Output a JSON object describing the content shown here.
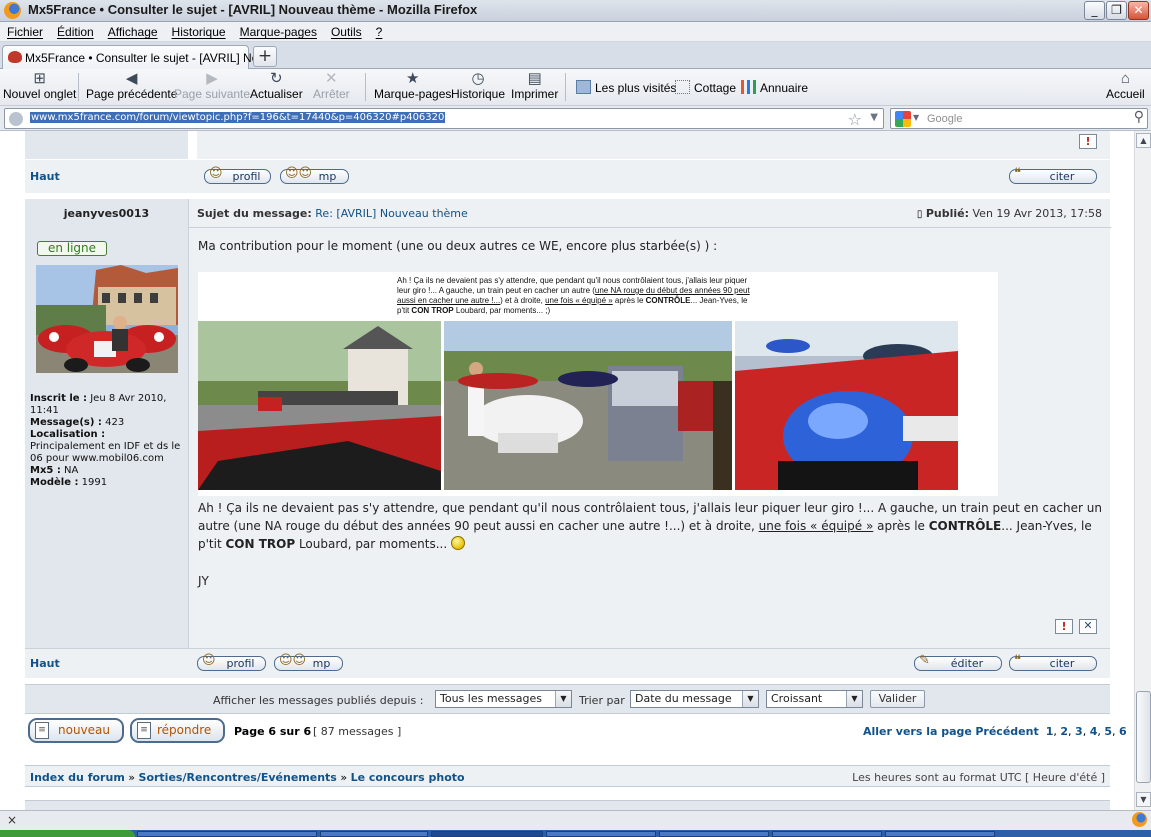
{
  "window": {
    "title": "Mx5France • Consulter le sujet - [AVRIL] Nouveau thème - Mozilla Firefox",
    "minimize": "_",
    "maximize": "❐",
    "close": "✕"
  },
  "menu": {
    "items": [
      "Fichier",
      "Édition",
      "Affichage",
      "Historique",
      "Marque-pages",
      "Outils",
      "?"
    ]
  },
  "tabs": {
    "active_label": "Mx5France • Consulter le sujet - [AVRIL] No...",
    "new_tab": "+"
  },
  "toolbar": {
    "new_tab": "Nouvel onglet",
    "back": "Page précédente",
    "forward": "Page suivante",
    "reload": "Actualiser",
    "stop": "Arrêter",
    "bookmarks": "Marque-pages",
    "history": "Historique",
    "print": "Imprimer",
    "bm_most_visited": "Les plus visités",
    "bm_cottage": "Cottage",
    "bm_annuaire": "Annuaire",
    "home": "Accueil"
  },
  "nav": {
    "url": "www.mx5france.com/forum/viewtopic.php?f=196&t=17440&p=406320#p406320",
    "search_placeholder": "Google"
  },
  "post_prev": {
    "haut": "Haut",
    "profil": "profil",
    "mp": "mp",
    "citer": "citer"
  },
  "post": {
    "author": "jeanyves0013",
    "subject_label": "Sujet du message:",
    "subject": "Re: [AVRIL] Nouveau thème",
    "posted_label": "Publié:",
    "posted": "Ven 19 Avr 2013, 17:58",
    "online": "en ligne",
    "profile": {
      "inscrit_label": "Inscrit le :",
      "inscrit": "Jeu 8 Avr 2010, 11:41",
      "messages_label": "Message(s) :",
      "messages": "423",
      "localisation_label": "Localisation :",
      "localisation": "Principalement en IDF et ds le 06 pour www.mobil06.com",
      "mx5_label": "Mx5 :",
      "mx5": "NA",
      "modele_label": "Modèle :",
      "modele": "1991"
    },
    "intro": "Ma contribution pour le moment (une ou deux autres ce WE, encore plus starbée(s) ) :",
    "image_caption_1": "Ah ! Ça ils ne devaient pas s'y attendre, que pendant qu'il nous contrôlaient tous, j'allais leur piquer leur giro !... A gauche, un train peut en cacher un autre (",
    "image_caption_2": "une NA rouge du début des années 90 peut aussi en cacher une autre !...",
    "image_caption_3": ") et à droite, ",
    "image_caption_4": "une fois « équipé »",
    "image_caption_5": " après le ",
    "image_caption_6": "CONTRÔLE",
    "image_caption_7": "... Jean-Yves, le p'tit ",
    "image_caption_8": "CON TROP",
    "image_caption_9": " Loubard, par moments... ;)",
    "body_1": "Ah ! Ça ils ne devaient pas s'y attendre, que pendant qu'il nous contrôlaient tous, j'allais leur piquer leur giro !... A gauche, un train peut en cacher un autre (une NA rouge du début des années 90 peut aussi en cacher une autre !...) et à droite, ",
    "body_link": "une fois « équipé »",
    "body_2": " après le ",
    "body_bold_1": "CONTRÔLE",
    "body_3": "... Jean-Yves, le p'tit ",
    "body_bold_2": "CON TROP",
    "body_4": " Loubard, par moments... ",
    "signature": "JY",
    "report": "!",
    "delete": "✕",
    "haut": "Haut",
    "profil": "profil",
    "mp": "mp",
    "editer": "éditer",
    "citer": "citer"
  },
  "filter": {
    "show_label": "Afficher les messages publiés depuis :",
    "show_value": "Tous les messages",
    "sort_label": "Trier par",
    "sort_value": "Date du message",
    "order_value": "Croissant",
    "submit": "Valider"
  },
  "pagination": {
    "new_topic": "nouveau",
    "reply": "répondre",
    "page_info": "Page 6 sur 6",
    "count": "[ 87 messages ]",
    "goto_label": "Aller vers la page",
    "prev": "Précédent",
    "pages": [
      "1",
      "2",
      "3",
      "4",
      "5",
      "6"
    ]
  },
  "breadcrumb": {
    "items": [
      "Index du forum",
      "Sorties/Rencontres/Evénements",
      "Le concours photo"
    ],
    "separator": "»",
    "timezone": "Les heures sont au format UTC [ Heure d'été ]"
  },
  "status": {
    "close": "×"
  },
  "colors": {
    "link": "#105289",
    "row_bg": "#eef1f4",
    "left_bg": "#e2e7ed",
    "online": "#2e7d1f"
  }
}
